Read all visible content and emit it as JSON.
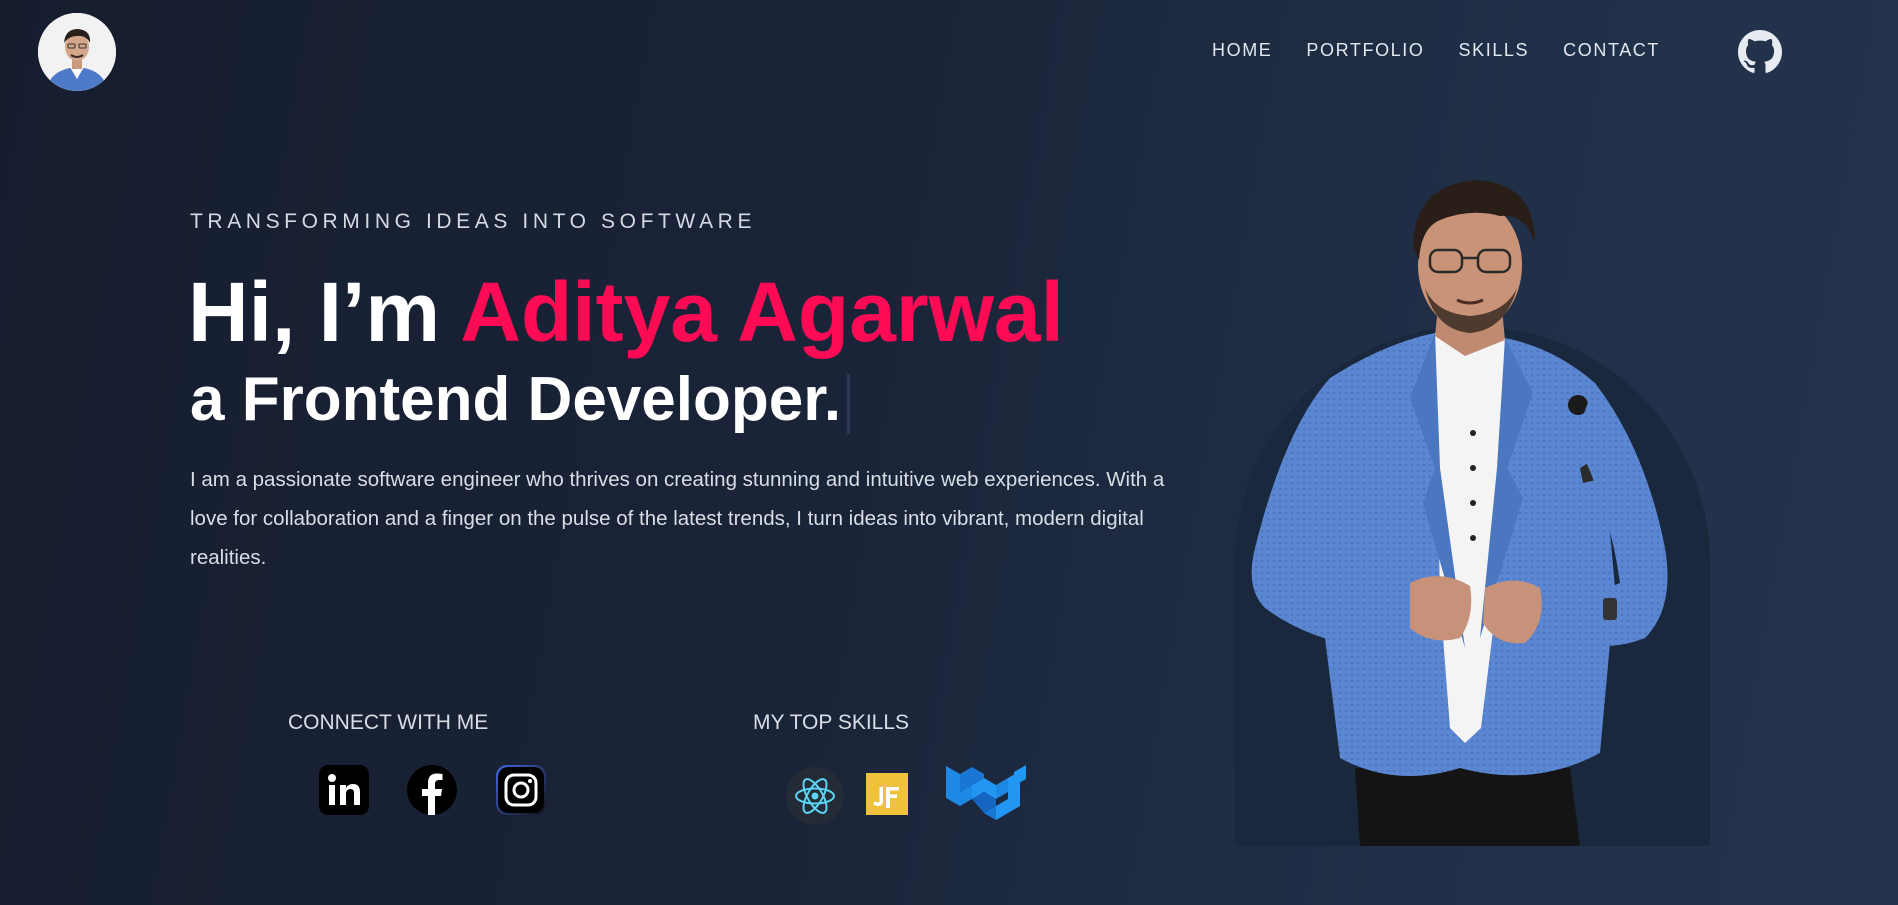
{
  "header": {
    "nav": [
      "HOME",
      "PORTFOLIO",
      "SKILLS",
      "CONTACT"
    ],
    "icons": {
      "avatar": "profile-photo",
      "github": "github-icon"
    }
  },
  "hero": {
    "tagline": "TRANSFORMING IDEAS INTO SOFTWARE",
    "greeting": "Hi, I’m",
    "name": "Aditya Agarwal",
    "role": "a Frontend Developer.",
    "intro": "I am a passionate software engineer who thrives on creating stunning and intuitive web experiences. With a love for collaboration and a finger on the pulse of the latest trends, I turn ideas into vibrant, modern digital realities."
  },
  "connect": {
    "title": "CONNECT WITH ME",
    "icons": [
      "linkedin-icon",
      "facebook-icon",
      "instagram-icon"
    ]
  },
  "skills": {
    "title": "MY TOP SKILLS",
    "icons": [
      "react-icon",
      "javascript-icon",
      "material-ui-icon"
    ]
  },
  "colors": {
    "accent": "#ff0a54",
    "background": "#1a2438",
    "text": "#ffffff"
  }
}
